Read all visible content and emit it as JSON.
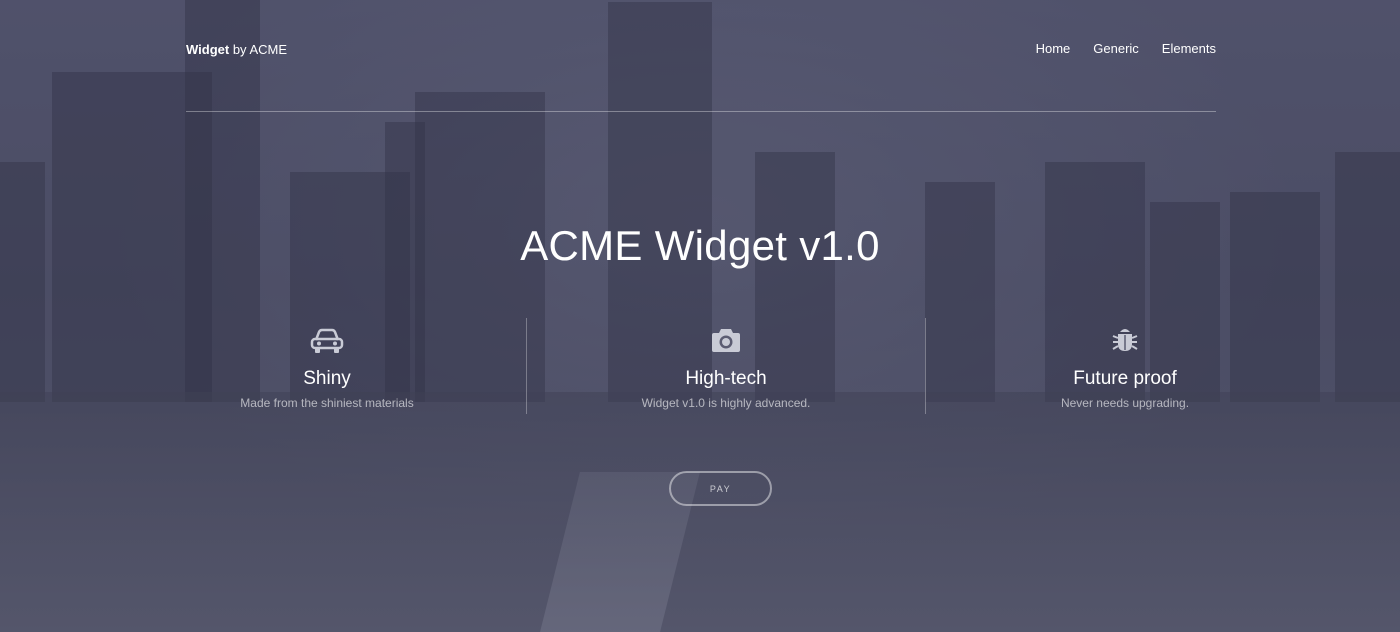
{
  "header": {
    "brand_bold": "Widget",
    "brand_rest": " by ACME",
    "nav": [
      {
        "label": "Home"
      },
      {
        "label": "Generic"
      },
      {
        "label": "Elements"
      }
    ]
  },
  "hero": {
    "title": "ACME Widget v1.0"
  },
  "features": [
    {
      "icon": "car-icon",
      "title": "Shiny",
      "description": "Made from the shiniest materials"
    },
    {
      "icon": "camera-icon",
      "title": "High-tech",
      "description": "Widget v1.0 is highly advanced."
    },
    {
      "icon": "bug-icon",
      "title": "Future proof",
      "description": "Never needs upgrading."
    }
  ],
  "cta": {
    "pay_label": "PAY"
  },
  "colors": {
    "overlay": "#4e4f64",
    "text": "#ffffff",
    "icon": "#c9cbd6"
  }
}
